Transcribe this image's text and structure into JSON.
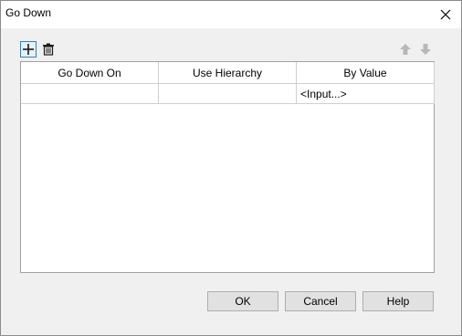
{
  "window": {
    "title": "Go Down",
    "close_icon": "close-icon"
  },
  "toolbar": {
    "add_icon": "plus-icon",
    "delete_icon": "trash-icon",
    "move_up_icon": "arrow-up-icon",
    "move_down_icon": "arrow-down-icon"
  },
  "table": {
    "columns": [
      "Go Down On",
      "Use Hierarchy",
      "By Value"
    ],
    "rows": [
      [
        "",
        "",
        "<Input...>"
      ]
    ]
  },
  "buttons": {
    "ok": "OK",
    "cancel": "Cancel",
    "help": "Help"
  },
  "colors": {
    "accent": "#3c7fb1",
    "disabled_icon": "#b8b8b8"
  }
}
